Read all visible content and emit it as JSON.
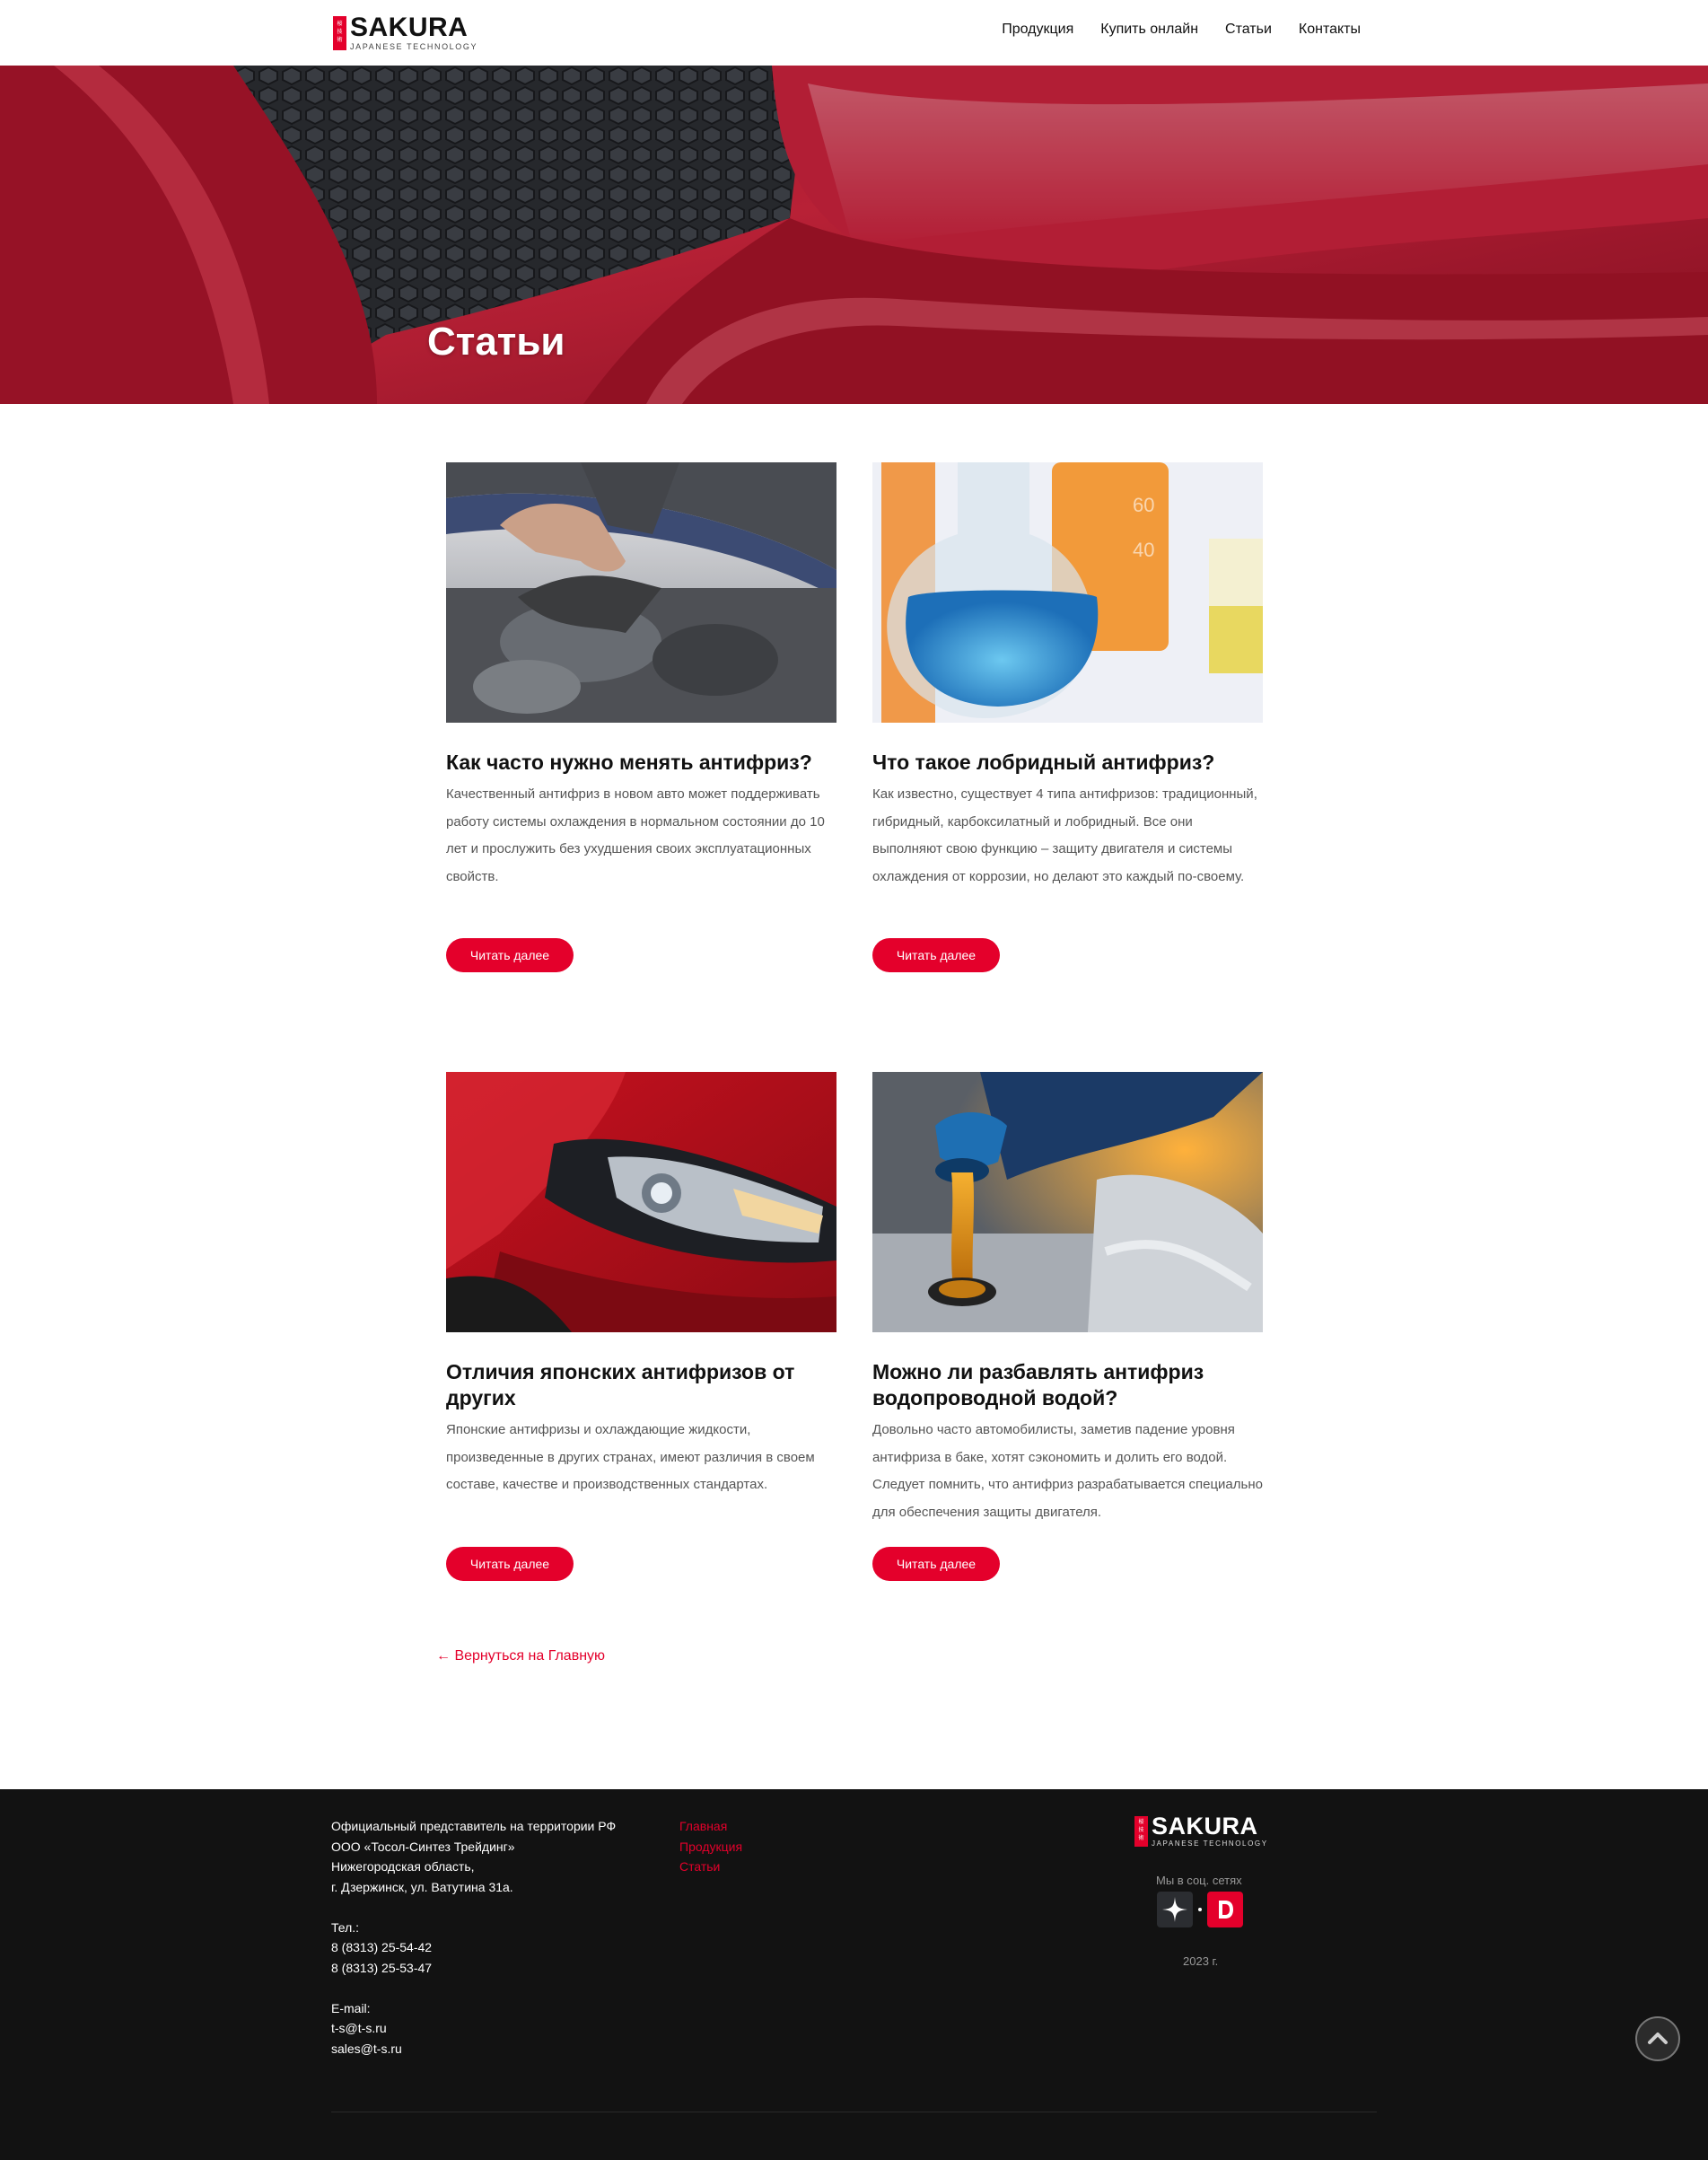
{
  "header": {
    "logo": {
      "brand": "SAKURA",
      "tagline": "JAPANESE TECHNOLOGY"
    },
    "nav": [
      "Продукция",
      "Купить онлайн",
      "Статьи",
      "Контакты"
    ]
  },
  "hero": {
    "title": "Статьи"
  },
  "articles": [
    {
      "title": "Как часто нужно менять антифриз?",
      "excerpt": "Качественный антифриз в новом авто может поддерживать работу системы охлаждения в нормальном состоянии до 10 лет и прослужить без ухудшения своих эксплуатационных свойств.",
      "button": "Читать далее"
    },
    {
      "title": "Что такое лобридный антифриз?",
      "excerpt": "Как известно, существует 4 типа антифризов: традиционный, гибридный, карбоксилатный и лобридный. Все они выполняют свою функцию – защиту двигателя и системы охлаждения от коррозии, но делают это каждый по-своему.",
      "button": "Читать далее"
    },
    {
      "title": "Отличия японских антифризов от других",
      "excerpt": "Японские антифризы и охлаждающие жидкости, произведенные в других странах, имеют различия в своем составе, качестве и производственных стандартах.",
      "button": "Читать далее"
    },
    {
      "title": "Можно ли разбавлять антифриз водопроводной водой?",
      "excerpt": "Довольно часто автомобилисты, заметив падение уровня антифриза в баке, хотят сэкономить и долить его водой. Следует помнить, что антифриз разрабатывается специально для обеспечения защиты двигателя.",
      "button": "Читать далее"
    }
  ],
  "back_link": "← Вернуться на Главную",
  "footer": {
    "address": [
      "Официальный представитель на территории РФ",
      "ООО «Тосол-Синтез Трейдинг»",
      "Нижегородская область,",
      "г. Дзержинск, ул. Ватутина 31а."
    ],
    "phone_label": "Тел.:",
    "phones": [
      "8 (8313) 25-54-42",
      "8 (8313) 25-53-47"
    ],
    "email_label": "E-mail:",
    "emails": [
      "t-s@t-s.ru",
      "sales@t-s.ru"
    ],
    "links": [
      "Главная",
      "Продукция",
      "Статьи"
    ],
    "social_label": "Мы в соц. сетях",
    "year": "2023 г.",
    "logo": {
      "brand": "SAKURA",
      "tagline": "JAPANESE TECHNOLOGY"
    }
  },
  "colors": {
    "accent": "#e4002b",
    "footer_bg": "#121212"
  },
  "icons": {
    "social_1": "zen-star-icon",
    "social_2": "dzen-d-icon",
    "scroll_top": "chevron-up-icon"
  }
}
